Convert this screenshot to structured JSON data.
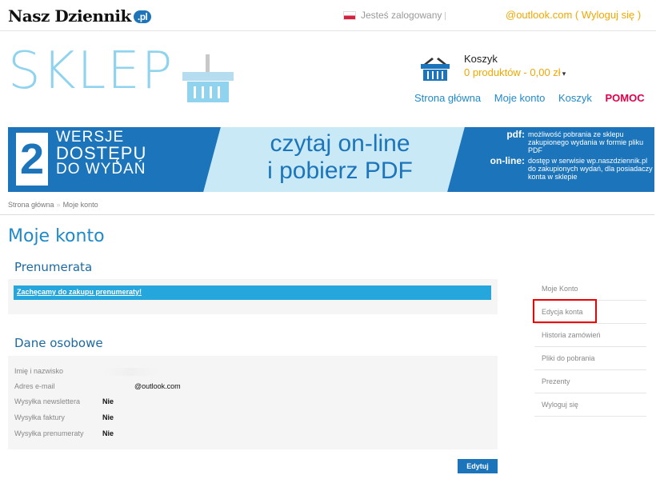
{
  "header": {
    "logo_text": "Nasz Dziennik",
    "logo_domain": ".pl",
    "logged_text": "Jesteś zalogowany",
    "email_fragment": "@outlook.com",
    "paren_open": "(",
    "logout_label": "Wyloguj się",
    "paren_close": ")"
  },
  "store": {
    "title": "SKLEP",
    "cart_title": "Koszyk",
    "cart_summary": "0 produktów - 0,00 zł",
    "cart_caret": "▾"
  },
  "nav": {
    "items": [
      "Strona główna",
      "Moje konto",
      "Koszyk"
    ],
    "help": "POMOC"
  },
  "banner": {
    "number": "2",
    "left_line1": "WERSJE",
    "left_line2": "DOSTĘPU",
    "left_line3": "DO WYDAŃ",
    "middle_line1": "czytaj on-line",
    "middle_line2": "i pobierz PDF",
    "pdf_key": "pdf:",
    "pdf_text": "możliwość pobrania ze sklepu zakupionego wydania w formie pliku PDF",
    "online_key": "on-line:",
    "online_text": "dostęp w serwisie wp.naszdziennik.pl do zakupionych wydań, dla posiadaczy konta w sklepie"
  },
  "breadcrumb": {
    "home": "Strona główna",
    "sep": "»",
    "current": "Moje konto"
  },
  "page_title": "Moje konto",
  "subscription": {
    "heading": "Prenumerata",
    "promo_link": "Zachęcamy do zakupu prenumeraty!"
  },
  "personal": {
    "heading": "Dane osobowe",
    "rows": [
      {
        "label": "Imię i nazwisko",
        "value": ""
      },
      {
        "label": "Adres e-mail",
        "value": "@outlook.com"
      },
      {
        "label": "Wysyłka newslettera",
        "value": "Nie"
      },
      {
        "label": "Wysyłka faktury",
        "value": "Nie"
      },
      {
        "label": "Wysyłka prenumeraty",
        "value": "Nie"
      }
    ],
    "edit_label": "Edytuj"
  },
  "sidebar": {
    "items": [
      "Moje Konto",
      "Edycja konta",
      "Historia zamówień",
      "Pliki do pobrania",
      "Prezenty",
      "Wyloguj się"
    ],
    "selected_index": 1,
    "highlight_color": "#e00000"
  },
  "colors": {
    "brand_blue": "#1c75bb",
    "link_blue": "#1f8ac9",
    "accent_orange": "#f0a800",
    "help_red": "#e2004a"
  }
}
